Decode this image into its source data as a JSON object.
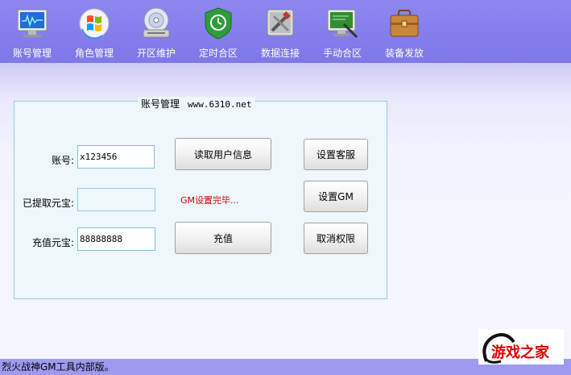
{
  "toolbar": {
    "items": [
      {
        "label": "账号管理",
        "icon": "monitor-icon"
      },
      {
        "label": "角色管理",
        "icon": "windows-logo-icon"
      },
      {
        "label": "开区维护",
        "icon": "cd-drive-icon"
      },
      {
        "label": "定时合区",
        "icon": "shield-icon"
      },
      {
        "label": "数据连接",
        "icon": "tools-icon"
      },
      {
        "label": "手动合区",
        "icon": "monitor-pen-icon"
      },
      {
        "label": "装备发放",
        "icon": "briefcase-icon"
      }
    ]
  },
  "group": {
    "title": "账号管理",
    "url": "www.6310.net"
  },
  "form": {
    "account_label": "账号:",
    "account_value": "x123456",
    "extracted_label": "已提取元宝:",
    "extracted_value": "",
    "recharge_label": "充值元宝:",
    "recharge_value": "88888888"
  },
  "buttons": {
    "read_user": "读取用户信息",
    "recharge": "充值",
    "set_service": "设置客服",
    "set_gm": "设置GM",
    "cancel_perm": "取消权限"
  },
  "status_message": "GM设置完毕...",
  "statusbar_text": "烈火战神GM工具内部版。",
  "logo": {
    "text": "游戏之家"
  },
  "colors": {
    "toolbar": "#8c87f0",
    "status_red": "#d00000",
    "group_border": "#8fcfe0"
  }
}
